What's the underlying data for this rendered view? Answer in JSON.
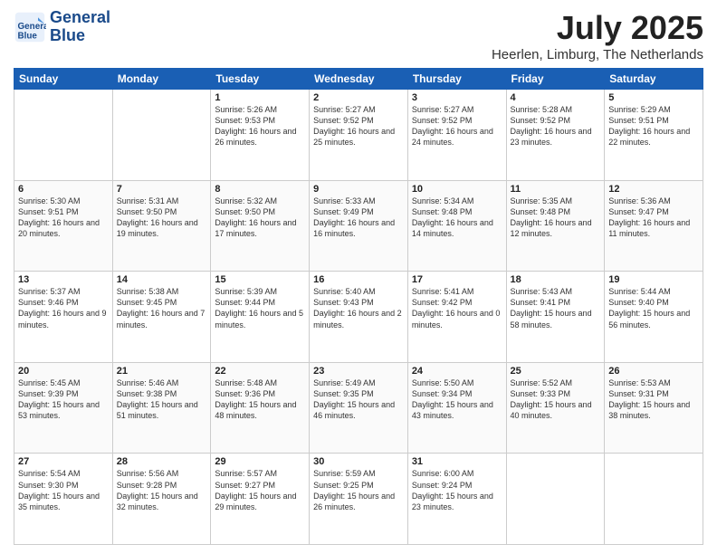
{
  "logo": {
    "line1": "General",
    "line2": "Blue"
  },
  "title": "July 2025",
  "subtitle": "Heerlen, Limburg, The Netherlands",
  "weekdays": [
    "Sunday",
    "Monday",
    "Tuesday",
    "Wednesday",
    "Thursday",
    "Friday",
    "Saturday"
  ],
  "weeks": [
    [
      {
        "day": "",
        "info": ""
      },
      {
        "day": "",
        "info": ""
      },
      {
        "day": "1",
        "info": "Sunrise: 5:26 AM\nSunset: 9:53 PM\nDaylight: 16 hours\nand 26 minutes."
      },
      {
        "day": "2",
        "info": "Sunrise: 5:27 AM\nSunset: 9:52 PM\nDaylight: 16 hours\nand 25 minutes."
      },
      {
        "day": "3",
        "info": "Sunrise: 5:27 AM\nSunset: 9:52 PM\nDaylight: 16 hours\nand 24 minutes."
      },
      {
        "day": "4",
        "info": "Sunrise: 5:28 AM\nSunset: 9:52 PM\nDaylight: 16 hours\nand 23 minutes."
      },
      {
        "day": "5",
        "info": "Sunrise: 5:29 AM\nSunset: 9:51 PM\nDaylight: 16 hours\nand 22 minutes."
      }
    ],
    [
      {
        "day": "6",
        "info": "Sunrise: 5:30 AM\nSunset: 9:51 PM\nDaylight: 16 hours\nand 20 minutes."
      },
      {
        "day": "7",
        "info": "Sunrise: 5:31 AM\nSunset: 9:50 PM\nDaylight: 16 hours\nand 19 minutes."
      },
      {
        "day": "8",
        "info": "Sunrise: 5:32 AM\nSunset: 9:50 PM\nDaylight: 16 hours\nand 17 minutes."
      },
      {
        "day": "9",
        "info": "Sunrise: 5:33 AM\nSunset: 9:49 PM\nDaylight: 16 hours\nand 16 minutes."
      },
      {
        "day": "10",
        "info": "Sunrise: 5:34 AM\nSunset: 9:48 PM\nDaylight: 16 hours\nand 14 minutes."
      },
      {
        "day": "11",
        "info": "Sunrise: 5:35 AM\nSunset: 9:48 PM\nDaylight: 16 hours\nand 12 minutes."
      },
      {
        "day": "12",
        "info": "Sunrise: 5:36 AM\nSunset: 9:47 PM\nDaylight: 16 hours\nand 11 minutes."
      }
    ],
    [
      {
        "day": "13",
        "info": "Sunrise: 5:37 AM\nSunset: 9:46 PM\nDaylight: 16 hours\nand 9 minutes."
      },
      {
        "day": "14",
        "info": "Sunrise: 5:38 AM\nSunset: 9:45 PM\nDaylight: 16 hours\nand 7 minutes."
      },
      {
        "day": "15",
        "info": "Sunrise: 5:39 AM\nSunset: 9:44 PM\nDaylight: 16 hours\nand 5 minutes."
      },
      {
        "day": "16",
        "info": "Sunrise: 5:40 AM\nSunset: 9:43 PM\nDaylight: 16 hours\nand 2 minutes."
      },
      {
        "day": "17",
        "info": "Sunrise: 5:41 AM\nSunset: 9:42 PM\nDaylight: 16 hours\nand 0 minutes."
      },
      {
        "day": "18",
        "info": "Sunrise: 5:43 AM\nSunset: 9:41 PM\nDaylight: 15 hours\nand 58 minutes."
      },
      {
        "day": "19",
        "info": "Sunrise: 5:44 AM\nSunset: 9:40 PM\nDaylight: 15 hours\nand 56 minutes."
      }
    ],
    [
      {
        "day": "20",
        "info": "Sunrise: 5:45 AM\nSunset: 9:39 PM\nDaylight: 15 hours\nand 53 minutes."
      },
      {
        "day": "21",
        "info": "Sunrise: 5:46 AM\nSunset: 9:38 PM\nDaylight: 15 hours\nand 51 minutes."
      },
      {
        "day": "22",
        "info": "Sunrise: 5:48 AM\nSunset: 9:36 PM\nDaylight: 15 hours\nand 48 minutes."
      },
      {
        "day": "23",
        "info": "Sunrise: 5:49 AM\nSunset: 9:35 PM\nDaylight: 15 hours\nand 46 minutes."
      },
      {
        "day": "24",
        "info": "Sunrise: 5:50 AM\nSunset: 9:34 PM\nDaylight: 15 hours\nand 43 minutes."
      },
      {
        "day": "25",
        "info": "Sunrise: 5:52 AM\nSunset: 9:33 PM\nDaylight: 15 hours\nand 40 minutes."
      },
      {
        "day": "26",
        "info": "Sunrise: 5:53 AM\nSunset: 9:31 PM\nDaylight: 15 hours\nand 38 minutes."
      }
    ],
    [
      {
        "day": "27",
        "info": "Sunrise: 5:54 AM\nSunset: 9:30 PM\nDaylight: 15 hours\nand 35 minutes."
      },
      {
        "day": "28",
        "info": "Sunrise: 5:56 AM\nSunset: 9:28 PM\nDaylight: 15 hours\nand 32 minutes."
      },
      {
        "day": "29",
        "info": "Sunrise: 5:57 AM\nSunset: 9:27 PM\nDaylight: 15 hours\nand 29 minutes."
      },
      {
        "day": "30",
        "info": "Sunrise: 5:59 AM\nSunset: 9:25 PM\nDaylight: 15 hours\nand 26 minutes."
      },
      {
        "day": "31",
        "info": "Sunrise: 6:00 AM\nSunset: 9:24 PM\nDaylight: 15 hours\nand 23 minutes."
      },
      {
        "day": "",
        "info": ""
      },
      {
        "day": "",
        "info": ""
      }
    ]
  ]
}
